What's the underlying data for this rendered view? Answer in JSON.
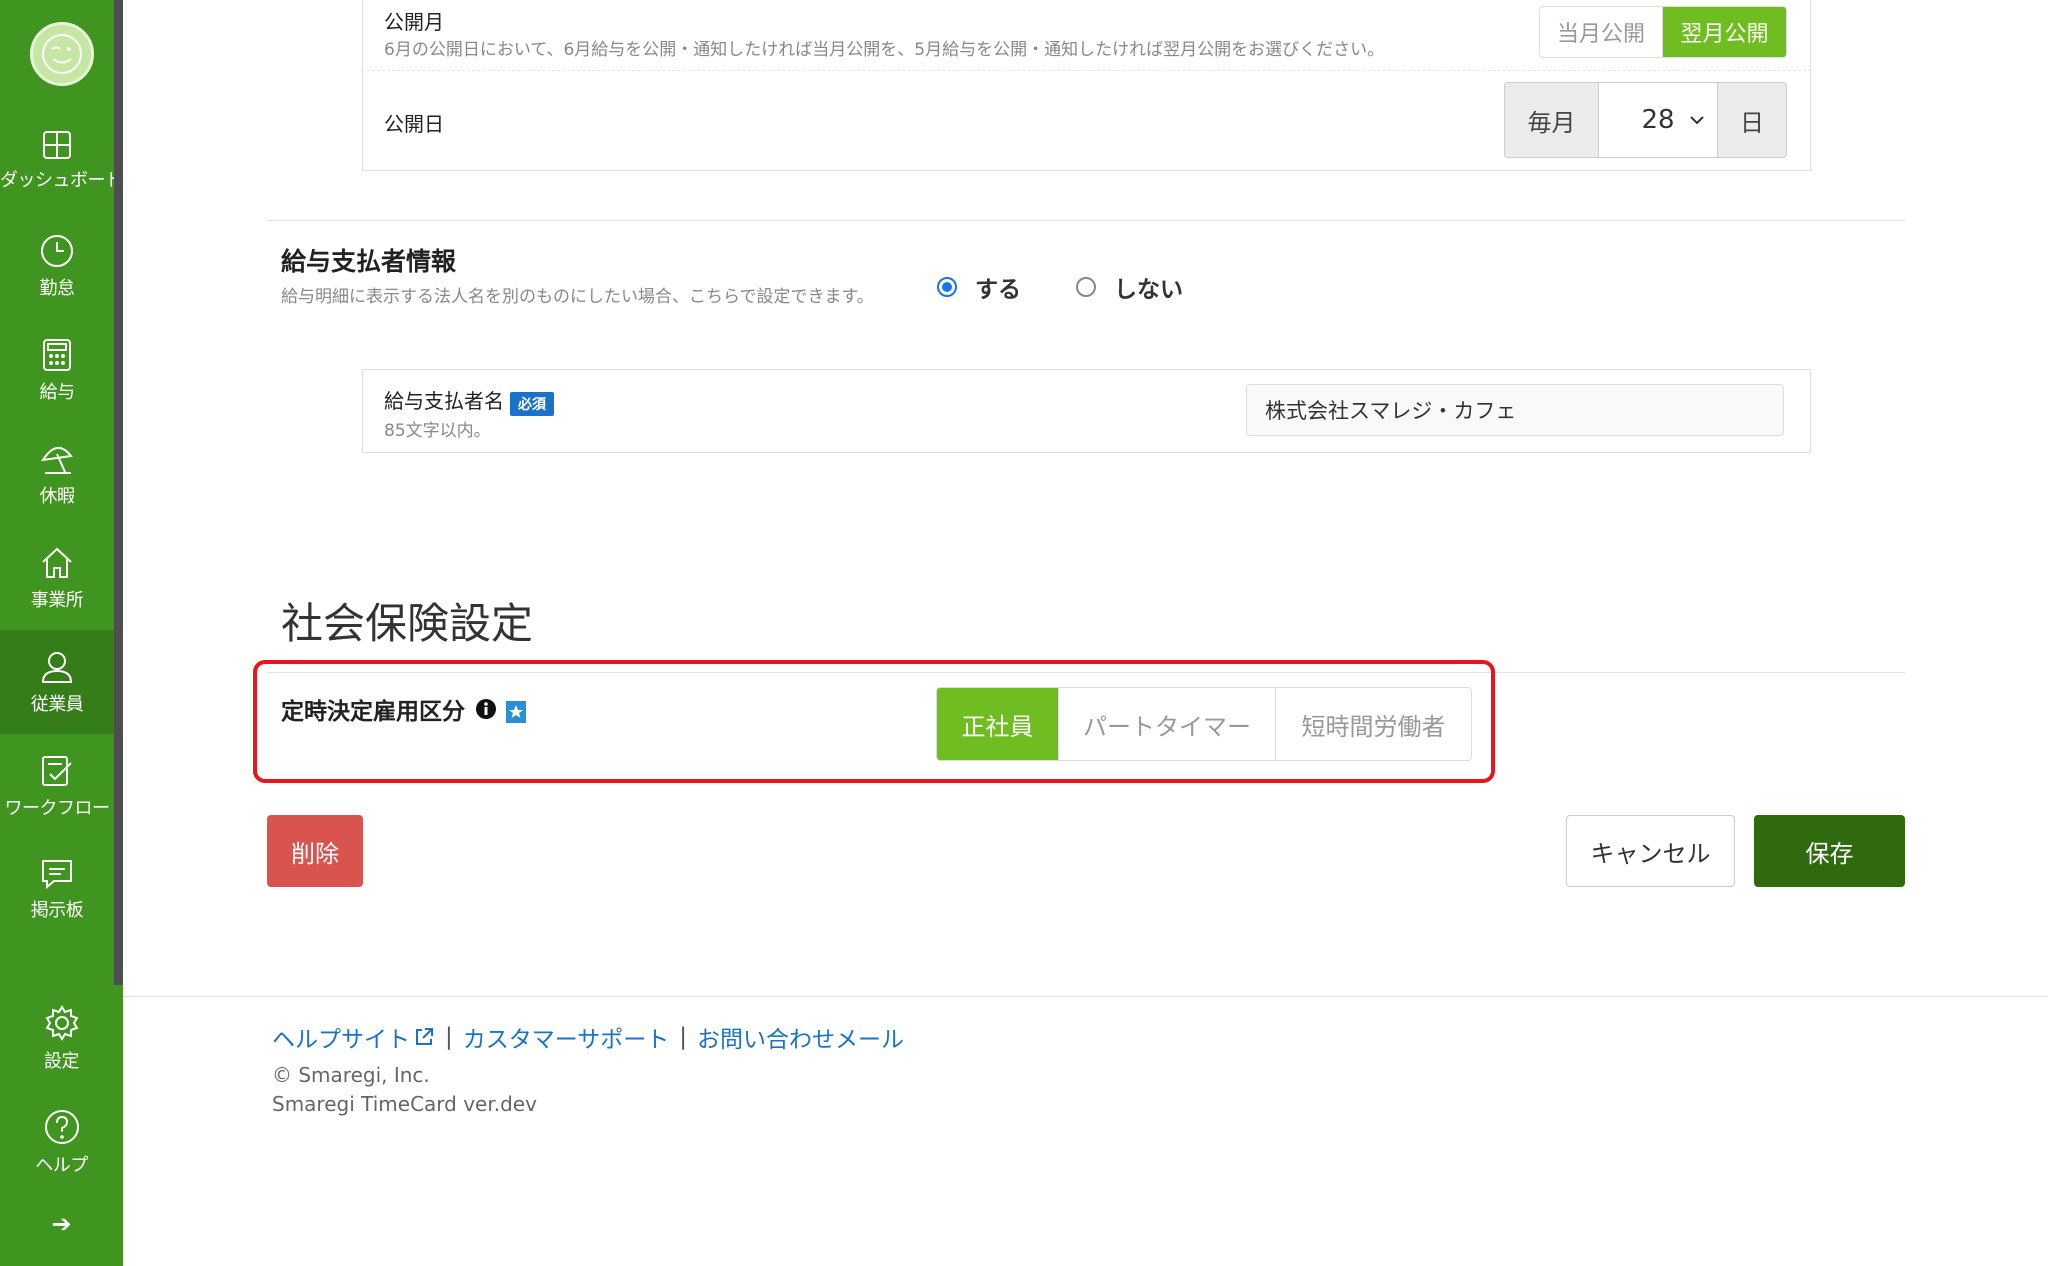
{
  "sidebar": {
    "items": [
      {
        "label": "ダッシュボード",
        "icon": "dashboard-icon"
      },
      {
        "label": "勤怠",
        "icon": "clock-icon"
      },
      {
        "label": "給与",
        "icon": "calculator-icon"
      },
      {
        "label": "休暇",
        "icon": "beach-umbrella-icon"
      },
      {
        "label": "事業所",
        "icon": "home-icon"
      },
      {
        "label": "従業員",
        "icon": "user-icon"
      },
      {
        "label": "ワークフロー",
        "icon": "workflow-icon"
      },
      {
        "label": "掲示板",
        "icon": "message-icon"
      }
    ],
    "bottom": [
      {
        "label": "設定",
        "icon": "gear-icon"
      },
      {
        "label": "ヘルプ",
        "icon": "help-icon"
      }
    ],
    "expand_arrow": "➔"
  },
  "publish_month": {
    "label": "公開月",
    "hint": "6月の公開日において、6月給与を公開・通知したければ当月公開を、5月給与を公開・通知したければ翌月公開をお選びください。",
    "options": [
      "当月公開",
      "翌月公開"
    ],
    "selected": "翌月公開"
  },
  "publish_day": {
    "label": "公開日",
    "prefix": "毎月",
    "value": "28",
    "suffix": "日"
  },
  "payer_info": {
    "title": "給与支払者情報",
    "hint": "給与明細に表示する法人名を別のものにしたい場合、こちらで設定できます。",
    "options": [
      "する",
      "しない"
    ],
    "selected": "する"
  },
  "payer_name": {
    "label": "給与支払者名",
    "required_badge": "必須",
    "hint": "85文字以内。",
    "value": "株式会社スマレジ・カフェ"
  },
  "social_insurance": {
    "title": "社会保険設定",
    "field_label": "定時決定雇用区分",
    "options": [
      "正社員",
      "パートタイマー",
      "短時間労働者"
    ],
    "selected": "正社員"
  },
  "actions": {
    "delete": "削除",
    "cancel": "キャンセル",
    "save": "保存"
  },
  "footer": {
    "links": [
      "ヘルプサイト",
      "カスタマーサポート",
      "お問い合わせメール"
    ],
    "copyright": "© Smaregi, Inc.",
    "version": "Smaregi TimeCard ver.dev"
  },
  "colors": {
    "sidebar": "#3f951f",
    "sidebar_active": "#347d18",
    "segment_on": "#6fbd21",
    "save": "#2f6b0e",
    "delete": "#d9534f",
    "link": "#1a73c8",
    "highlight": "#e8141e"
  }
}
